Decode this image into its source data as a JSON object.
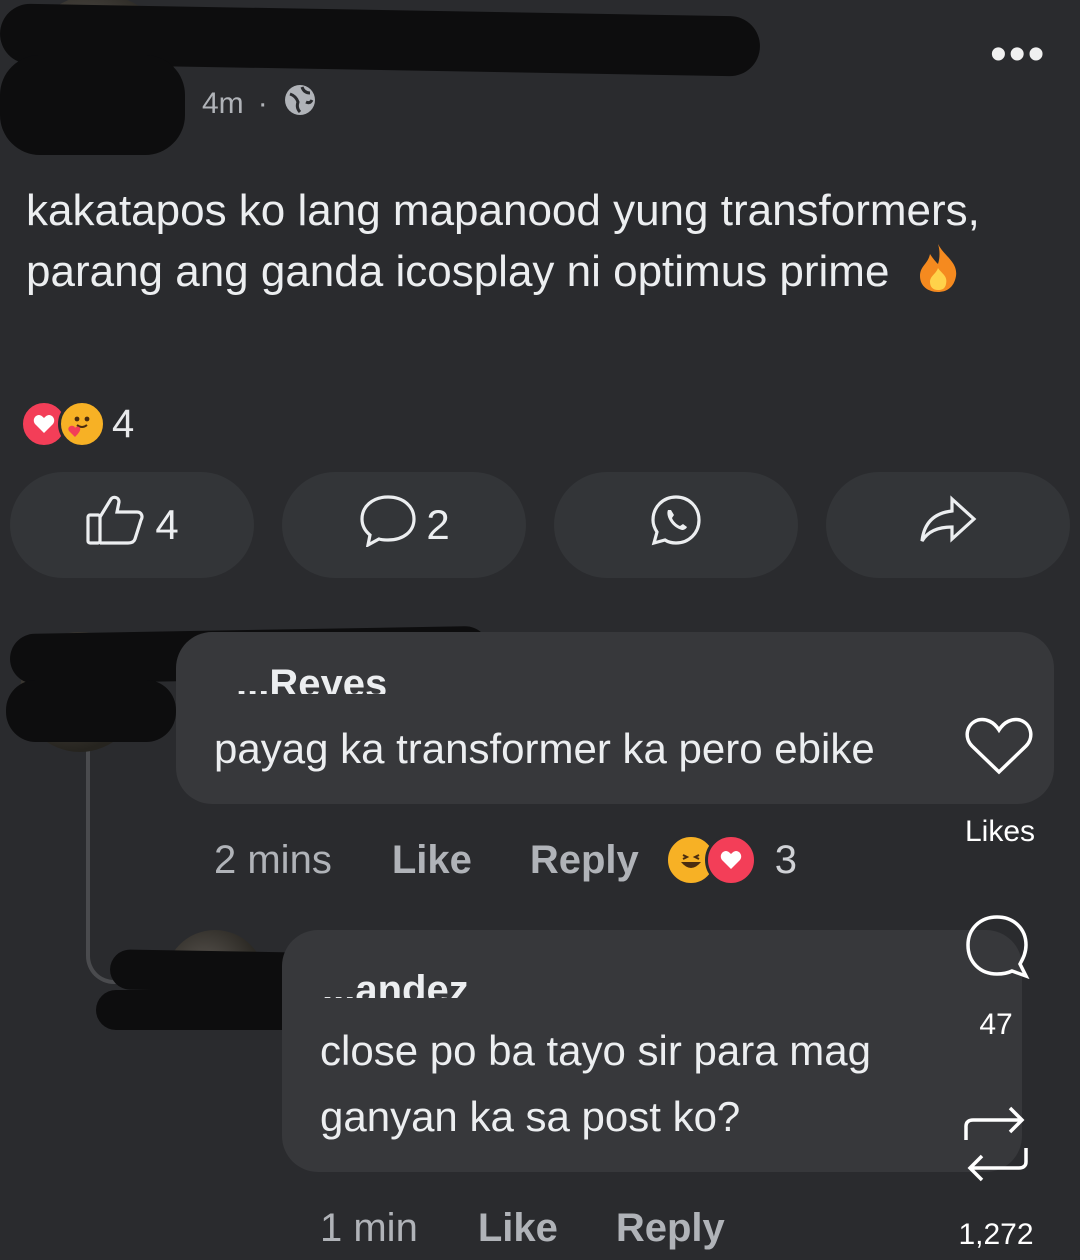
{
  "post": {
    "timestamp": "4m",
    "separator": "·",
    "privacy_icon": "globe-icon",
    "more_icon": "•••",
    "text": "kakatapos ko lang mapanood yung transformers, parang ang ganda icosplay ni optimus prime",
    "emoji": "fire",
    "reaction_count": "4",
    "reaction_icons": [
      "love",
      "care"
    ]
  },
  "actions": {
    "like_count": "4",
    "comment_count": "2"
  },
  "comments": [
    {
      "author_partial": "...Reyes",
      "text": "payag ka transformer ka pero ebike",
      "time": "2 mins",
      "like_label": "Like",
      "reply_label": "Reply",
      "reaction_count": "3"
    },
    {
      "author_partial": "...andez",
      "text": "close po ba tayo sir para mag ganyan ka sa post ko?",
      "time": "1 min",
      "like_label": "Like",
      "reply_label": "Reply"
    }
  ],
  "sidebar": {
    "likes_label": "Likes",
    "comments_count": "47",
    "reposts_count": "1,272"
  },
  "colors": {
    "background": "#2a2b2e",
    "bubble": "#37383b",
    "love": "#f33e58",
    "care": "#f7b125"
  }
}
